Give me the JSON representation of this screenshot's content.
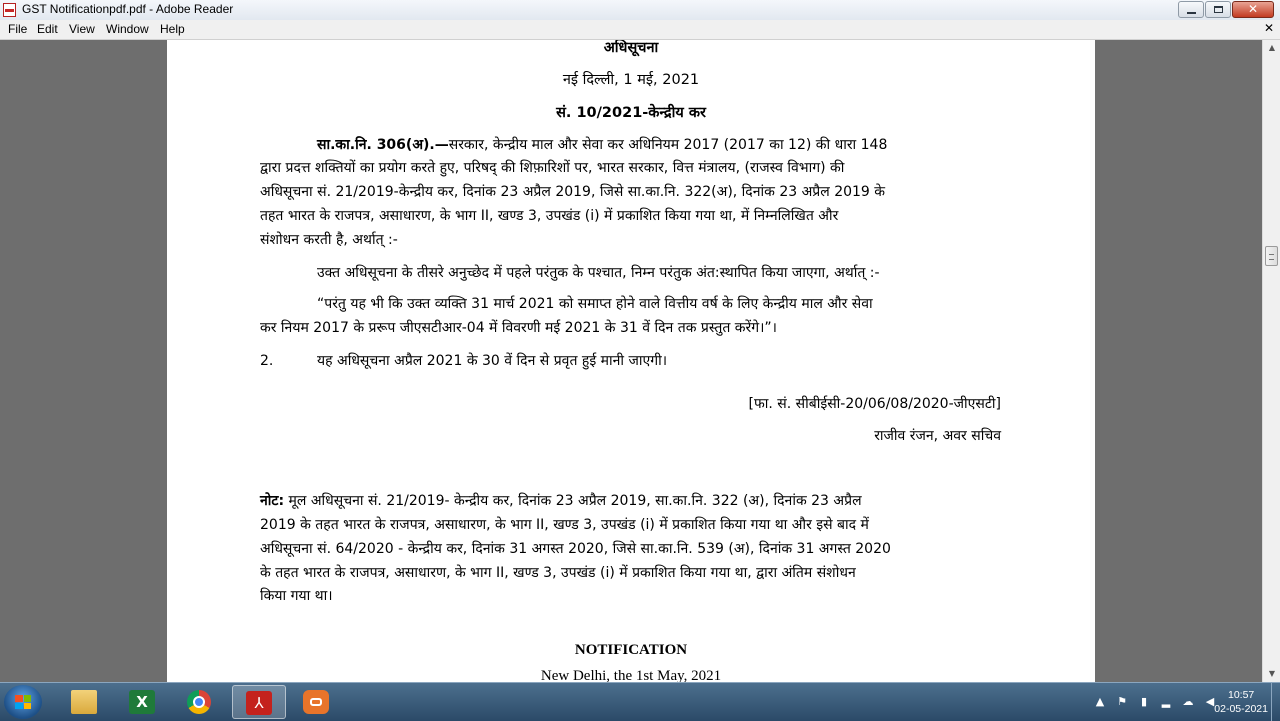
{
  "window": {
    "title": "GST Notificationpdf.pdf - Adobe Reader"
  },
  "menu": {
    "items": [
      "File",
      "Edit",
      "View",
      "Window",
      "Help"
    ]
  },
  "document": {
    "hindi": {
      "heading": "अधिसूचना",
      "place_date": "नई दिल्ली, 1 मई, 2021",
      "number": "सं. 10/2021-केन्द्रीय कर",
      "para1": {
        "lead": "सा.का.नि. 306(अ).—",
        "lines": [
          "सरकार, केन्द्रीय माल और सेवा कर अधिनियम 2017 (2017 का 12) की धारा 148",
          "द्वारा प्रदत्त शक्तियों का प्रयोग करते हुए, परिषद् की शिफ़ारिशों पर, भारत सरकार, वित्त मंत्रालय, (राजस्व विभाग) की",
          "अधिसूचना सं. 21/2019-केन्द्रीय कर, दिनांक 23 अप्रैल 2019, जिसे  सा.का.नि. 322(अ), दिनांक 23 अप्रैल 2019  के",
          "तहत भारत के राजपत्र, असाधारण, के भाग II, खण्ड 3, उपखंड (i) में प्रकाशित किया गया था, में निम्नलिखित और",
          "संशोधन करती है,  अर्थात् :-"
        ]
      },
      "para2": "उक्त अधिसूचना के तीसरे अनुच्छेद में पहले परंतुक के पश्चात, निम्न परंतुक अंत:स्थापित किया जाएगा, अर्थात् :-",
      "proviso": [
        "“परंतु यह भी कि उक्त व्यक्ति 31 मार्च 2021 को समाप्त होने वाले वित्तीय वर्ष के लिए  केन्द्रीय माल और सेवा",
        "कर नियम 2017 के  प्ररूप जीएसटीआर-04  में विवरणी मई 2021 के 31 वें दिन तक प्रस्तुत करेंगे।”।"
      ],
      "item2": {
        "num": "2.",
        "text": "यह अधिसूचना अप्रैल 2021 के 30 वें दिन से प्रवृत हुई मानी जाएगी।"
      },
      "file_no": "[फा. सं. सीबीईसी-20/06/08/2020-जीएसटी]",
      "signatory": "राजीव रंजन, अवर सचिव",
      "note": {
        "label": "नोट:",
        "lines": [
          " मूल अधिसूचना सं. 21/2019- केन्द्रीय कर, दिनांक 23 अप्रैल 2019,  सा.का.नि. 322 (अ), दिनांक 23 अप्रैल",
          "2019  के तहत भारत के राजपत्र, असाधारण, के भाग II, खण्ड 3, उपखंड (i) में प्रकाशित किया गया था और इसे बाद में",
          "अधिसूचना सं. 64/2020 - केन्द्रीय कर, दिनांक 31 अगस्त 2020, जिसे सा.का.नि. 539 (अ), दिनांक 31 अगस्त 2020",
          "के तहत भारत के राजपत्र, असाधारण, के भाग II, खण्ड 3, उपखंड (i) में प्रकाशित किया गया था, द्वारा अंतिम संशोधन",
          "किया गया था।"
        ]
      }
    },
    "english": {
      "heading": "NOTIFICATION",
      "place_date": "New Delhi, the 1st May, 2021"
    }
  },
  "taskbar": {
    "apps": [
      "folder-icon",
      "excel-icon",
      "chrome-icon",
      "acrobat-icon",
      "screen-recorder-icon"
    ],
    "active_app": "acrobat-icon",
    "time": "10:57",
    "date": "02-05-2021",
    "colors": {
      "start_blue": "#1d4f86",
      "acrobat_red": "#c4221d",
      "excel_green": "#1f7a3a"
    }
  }
}
